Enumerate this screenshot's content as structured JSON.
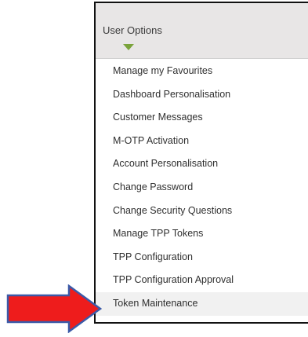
{
  "menu": {
    "title": "User Options",
    "items": [
      {
        "label": "Manage my Favourites"
      },
      {
        "label": "Dashboard Personalisation"
      },
      {
        "label": "Customer Messages"
      },
      {
        "label": "M-OTP Activation"
      },
      {
        "label": "Account Personalisation"
      },
      {
        "label": "Change Password"
      },
      {
        "label": "Change Security Questions"
      },
      {
        "label": "Manage TPP Tokens"
      },
      {
        "label": "TPP Configuration"
      },
      {
        "label": "TPP Configuration Approval"
      },
      {
        "label": "Token Maintenance"
      }
    ],
    "selected_item": "Token Maintenance"
  },
  "colors": {
    "header_bg": "#e8e6e6",
    "caret": "#7aa33b",
    "arrow_fill": "#ee1c1c",
    "arrow_stroke": "#3b5aa8",
    "border": "#111111"
  },
  "icons": {
    "header_caret": "caret-down-icon",
    "pointer": "right-arrow-icon"
  }
}
